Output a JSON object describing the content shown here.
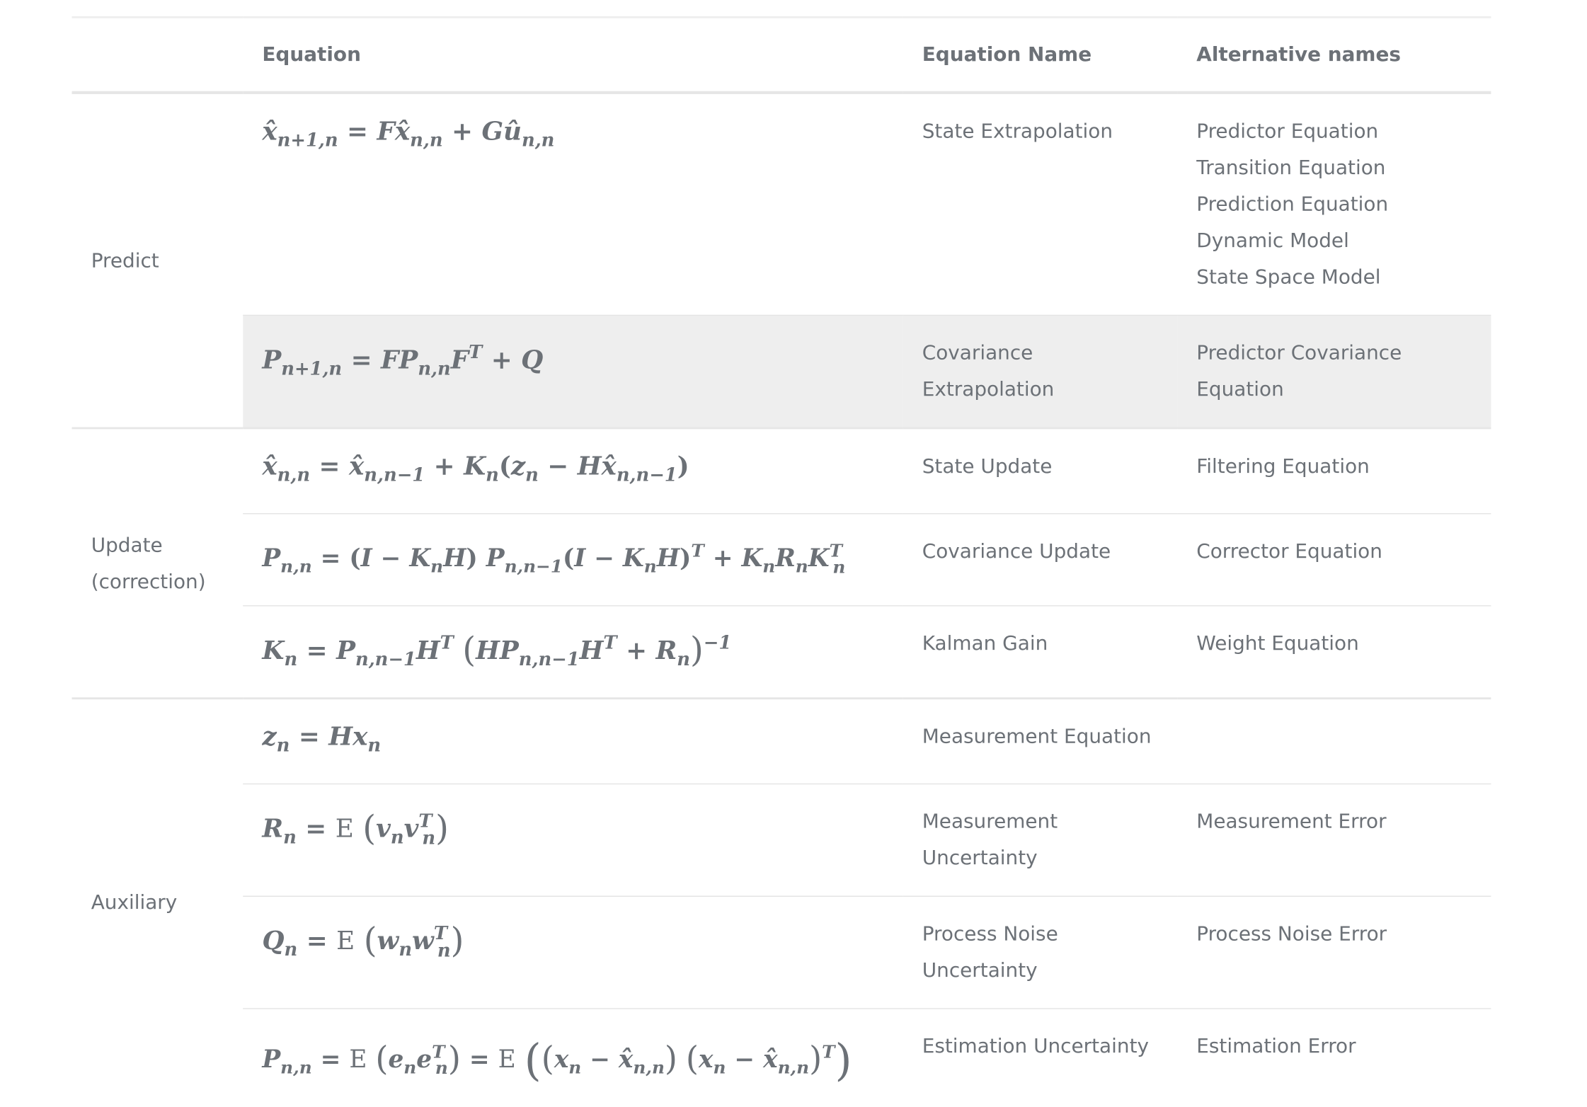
{
  "table": {
    "headers": {
      "group": "",
      "equation": "Equation",
      "name": "Equation Name",
      "alternatives": "Alternative names"
    },
    "groups": {
      "predict": "Predict",
      "update": "Update\n(correction)",
      "auxiliary": "Auxiliary"
    },
    "rows": [
      {
        "equation": "x̂_{n+1,n} = F x̂_{n,n} + G û_{n,n}",
        "name": "State Extrapolation",
        "alternatives": [
          "Predictor Equation",
          "Transition Equation",
          "Prediction Equation",
          "Dynamic Model",
          "State Space Model"
        ]
      },
      {
        "equation": "P_{n+1,n} = F P_{n,n} F^T + Q",
        "name": "Covariance Extrapolation",
        "alternatives": [
          "Predictor Covariance Equation"
        ]
      },
      {
        "equation": "x̂_{n,n} = x̂_{n,n−1} + K_n (z_n − H x̂_{n,n−1})",
        "name": "State Update",
        "alternatives": [
          "Filtering Equation"
        ]
      },
      {
        "equation": "P_{n,n} = (I − K_n H) P_{n,n−1} (I − K_n H)^T + K_n R_n K_n^T",
        "name": "Covariance Update",
        "alternatives": [
          "Corrector Equation"
        ]
      },
      {
        "equation": "K_n = P_{n,n−1} H^T (H P_{n,n−1} H^T + R_n)^{−1}",
        "name": "Kalman Gain",
        "alternatives": [
          "Weight Equation"
        ]
      },
      {
        "equation": "z_n = H x_n",
        "name": "Measurement Equation",
        "alternatives": []
      },
      {
        "equation": "R_n = E (v_n v_n^T)",
        "name": "Measurement Uncertainty",
        "alternatives": [
          "Measurement Error"
        ]
      },
      {
        "equation": "Q_n = E (w_n w_n^T)",
        "name": "Process Noise Uncertainty",
        "alternatives": [
          "Process Noise Error"
        ]
      },
      {
        "equation": "P_{n,n} = E (e_n e_n^T) = E ((x_n − x̂_{n,n}) (x_n − x̂_{n,n})^T)",
        "name": "Estimation Uncertainty",
        "alternatives": [
          "Estimation Error"
        ]
      }
    ]
  },
  "math": {
    "eq": "=",
    "plus": "+",
    "minus": "−",
    "lp": "(",
    "rp": ")",
    "T": "T",
    "inv": "−1",
    "E": "E",
    "xhat": "x̂",
    "uhat": "û",
    "x": "x",
    "z": "z",
    "v": "v",
    "w": "w",
    "e": "e",
    "F": "F",
    "G": "G",
    "H": "H",
    "I": "I",
    "K": "K",
    "P": "P",
    "Q": "Q",
    "R": "R",
    "n": "n",
    "n1n": "n+1,n",
    "nn": "n,n",
    "nn1": "n,n−1"
  }
}
